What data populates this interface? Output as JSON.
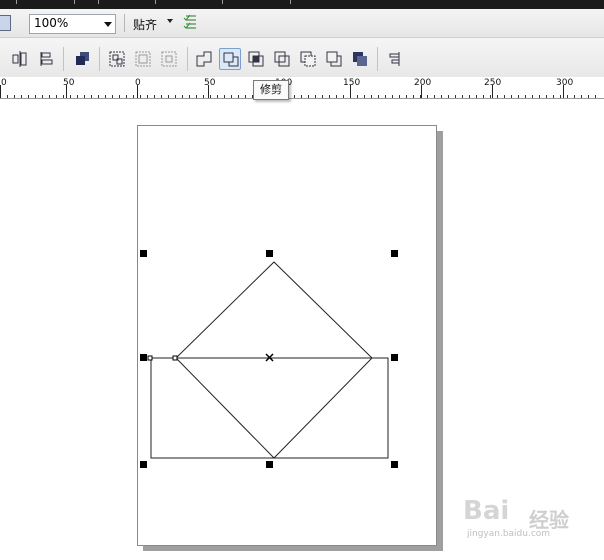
{
  "toolbar": {
    "zoom_value": "100%",
    "snap_label": "贴齐"
  },
  "ruler": {
    "labels": [
      "0",
      "50",
      "0",
      "50",
      "100",
      "150",
      "200",
      "250",
      "300"
    ]
  },
  "tooltip": {
    "text": "修剪"
  },
  "watermark": {
    "logo": "Bai",
    "logo_cn": "经验",
    "subtitle": "jingyan.baidu.com"
  },
  "colors": {
    "active_border": "#7aa0d0",
    "active_bg": "#dbe8f8",
    "page_shadow": "#9f9f9f"
  }
}
